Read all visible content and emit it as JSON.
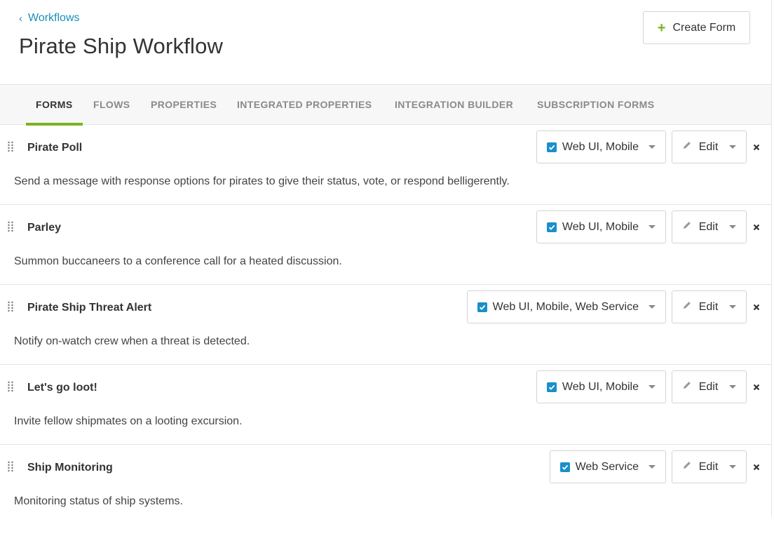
{
  "header": {
    "breadcrumb_label": "Workflows",
    "title": "Pirate Ship Workflow",
    "create_button_label": "Create Form"
  },
  "tabs": [
    {
      "label": "FORMS",
      "active": true
    },
    {
      "label": "FLOWS",
      "active": false
    },
    {
      "label": "PROPERTIES",
      "active": false
    },
    {
      "label": "INTEGRATED PROPERTIES",
      "active": false
    },
    {
      "label": "INTEGRATION BUILDER",
      "active": false
    },
    {
      "label": "SUBSCRIPTION FORMS",
      "active": false
    }
  ],
  "forms": [
    {
      "title": "Pirate Poll",
      "description": "Send a message with response options for pirates to give their status, vote, or respond belligerently.",
      "channels": "Web UI, Mobile",
      "edit_label": "Edit"
    },
    {
      "title": "Parley",
      "description": "Summon buccaneers to a conference call for a heated discussion.",
      "channels": "Web UI, Mobile",
      "edit_label": "Edit"
    },
    {
      "title": "Pirate Ship Threat Alert",
      "description": "Notify on-watch crew when a threat is detected.",
      "channels": "Web UI, Mobile, Web Service",
      "edit_label": "Edit"
    },
    {
      "title": "Let's go loot!",
      "description": "Invite fellow shipmates on a looting excursion.",
      "channels": "Web UI, Mobile",
      "edit_label": "Edit"
    },
    {
      "title": "Ship Monitoring",
      "description": "Monitoring status of ship systems.",
      "channels": "Web Service",
      "edit_label": "Edit"
    }
  ],
  "colors": {
    "link": "#1b8fb8",
    "accent_green": "#7ab51d",
    "checkbox_blue": "#1a8fc9"
  },
  "icons": {
    "breadcrumb": "chevron-left-icon",
    "create": "plus-icon",
    "drag": "drag-handle-icon",
    "checkbox": "checkbox-checked-icon",
    "dropdown": "caret-down-icon",
    "edit": "pencil-icon",
    "delete": "close-icon"
  }
}
